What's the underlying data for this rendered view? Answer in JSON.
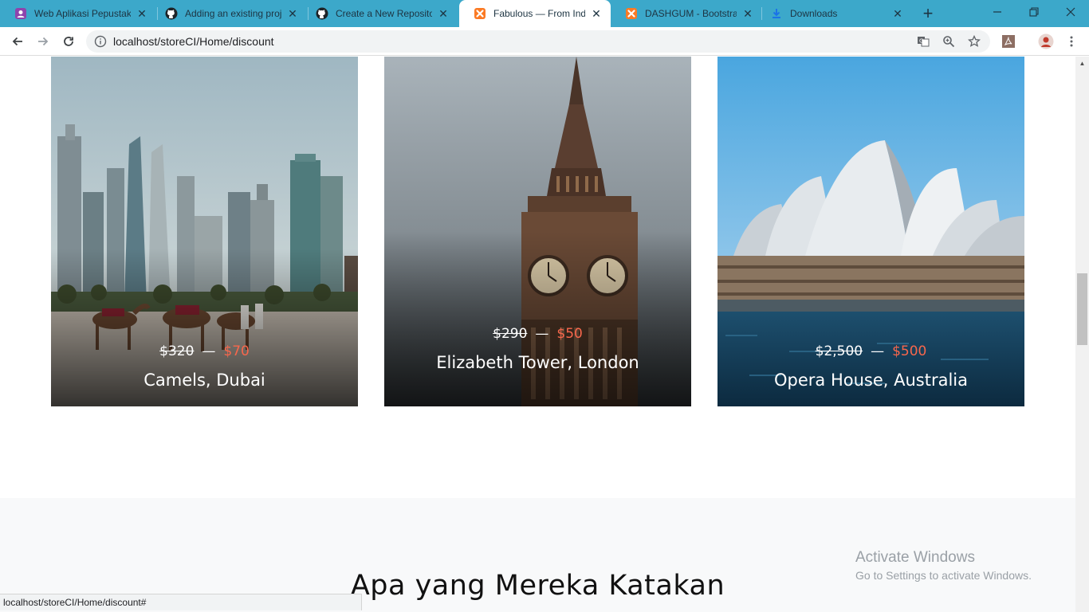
{
  "browser": {
    "tabs": [
      {
        "title": "Web Aplikasi Pepustakaan",
        "icon": "user-profile-icon",
        "active": false
      },
      {
        "title": "Adding an existing project",
        "icon": "github-icon",
        "active": false
      },
      {
        "title": "Create a New Repository",
        "icon": "github-icon",
        "active": false
      },
      {
        "title": "Fabulous — From Indonesia",
        "icon": "xampp-icon",
        "active": true
      },
      {
        "title": "DASHGUM - Bootstrap",
        "icon": "xampp-icon",
        "active": false
      },
      {
        "title": "Downloads",
        "icon": "download-icon",
        "active": false
      }
    ],
    "url": "localhost/storeCI/Home/discount",
    "status_url": "localhost/storeCI/Home/discount#"
  },
  "cards": [
    {
      "old_price": "$320",
      "dash": "—",
      "new_price": "$70",
      "title": "Camels, Dubai"
    },
    {
      "old_price": "$290",
      "dash": "—",
      "new_price": "$50",
      "title": "Elizabeth Tower, London"
    },
    {
      "old_price": "$2,500",
      "dash": "—",
      "new_price": "$500",
      "title": "Opera House, Australia"
    }
  ],
  "testimonial": {
    "heading": "Apa yang Mereka Katakan"
  },
  "watermark": {
    "line1": "Activate Windows",
    "line2": "Go to Settings to activate Windows."
  },
  "colors": {
    "tabbar": "#3ca8ca",
    "accent_price": "#f8674c",
    "section_bg": "#f8f9fa"
  }
}
